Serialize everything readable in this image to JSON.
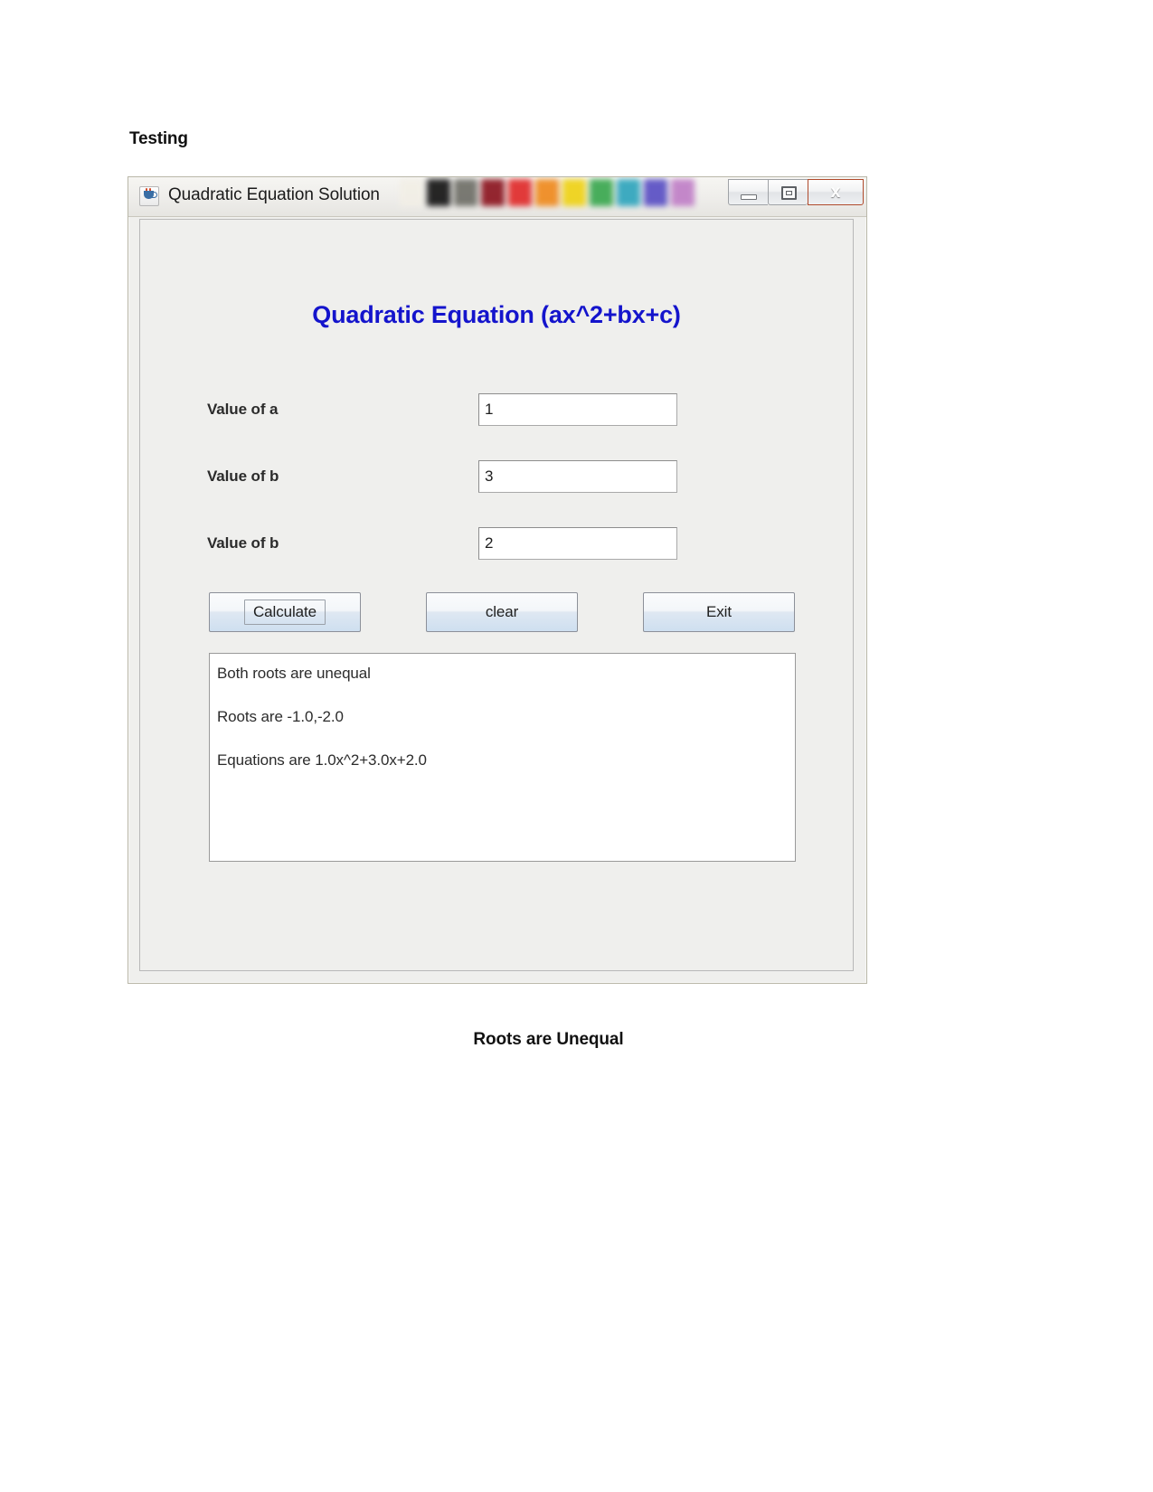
{
  "document": {
    "heading": "Testing",
    "caption": "Roots are Unequal"
  },
  "window": {
    "title": "Quadratic Equation Solution",
    "app_icon": "java-coffee-cup-icon",
    "controls": {
      "minimize_label": "",
      "maximize_label": "",
      "close_label": "x"
    },
    "palette_colors": [
      "#f2efe6",
      "#151515",
      "#6f6f68",
      "#8c1520",
      "#e02b2b",
      "#ef8a1e",
      "#efd216",
      "#3aa84f",
      "#2fa5bd",
      "#5a4fc4",
      "#c07fc7"
    ]
  },
  "panel": {
    "title": "Quadratic Equation (ax^2+bx+c)",
    "title_color": "#1414cc",
    "fields": [
      {
        "label": "Value of a",
        "value": "1",
        "placeholder": ""
      },
      {
        "label": "Value of b",
        "value": "3",
        "placeholder": ""
      },
      {
        "label": "Value of b",
        "value": "2",
        "placeholder": ""
      }
    ],
    "buttons": [
      {
        "label": "Calculate",
        "focused": true
      },
      {
        "label": "clear",
        "focused": false
      },
      {
        "label": "Exit",
        "focused": false
      }
    ],
    "result": {
      "line1": "Both roots are unequal",
      "line2": "Roots are -1.0,-2.0",
      "line3": "Equations are 1.0x^2+3.0x+2.0"
    }
  }
}
